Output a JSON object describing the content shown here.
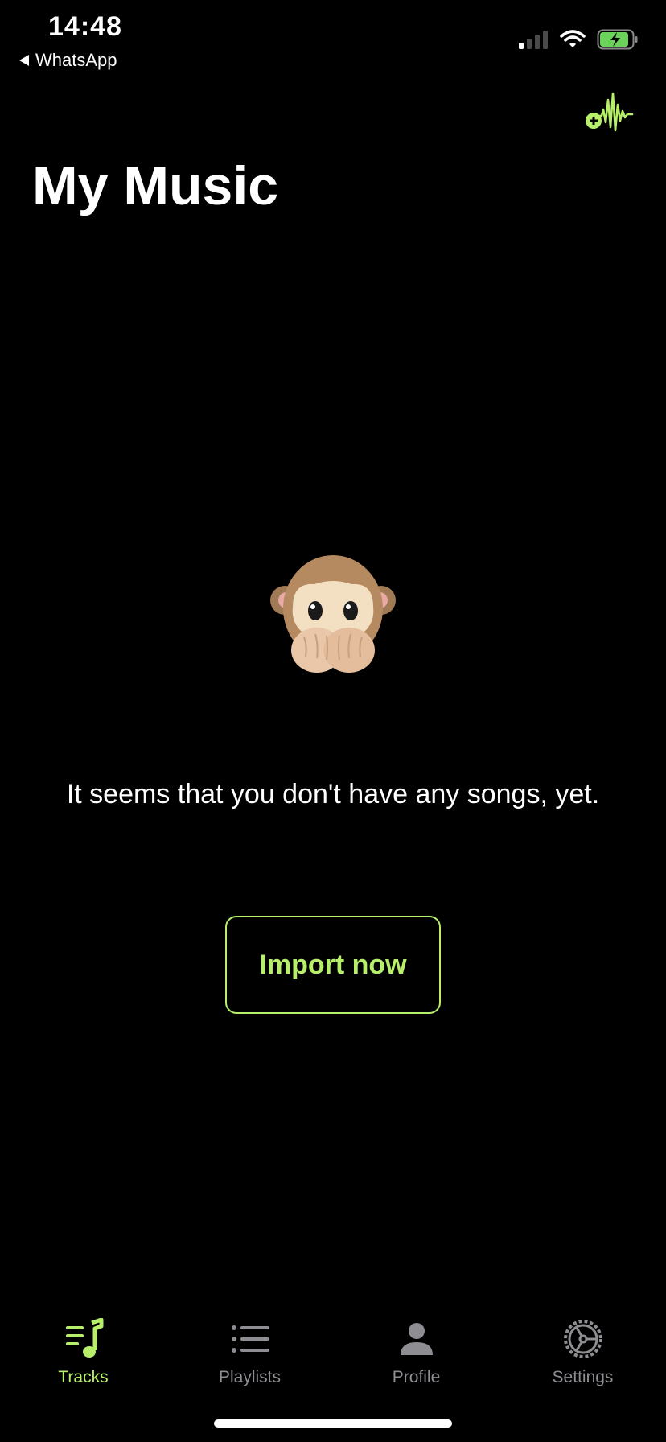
{
  "status_bar": {
    "time": "14:48",
    "back_app": "WhatsApp",
    "signal_icon": "cellular-signal-icon",
    "wifi_icon": "wifi-icon",
    "battery_icon": "battery-charging-icon"
  },
  "header": {
    "action_icon": "add-audio-waveform-icon",
    "title": "My Music"
  },
  "empty_state": {
    "illustration": "see-no-evil-monkey-speak-no-evil-monkey",
    "message": "It seems that you don't have any songs, yet.",
    "button_label": "Import now"
  },
  "tab_bar": {
    "tabs": [
      {
        "label": "Tracks",
        "icon": "music-list-icon",
        "active": true
      },
      {
        "label": "Playlists",
        "icon": "list-icon",
        "active": false
      },
      {
        "label": "Profile",
        "icon": "person-icon",
        "active": false
      },
      {
        "label": "Settings",
        "icon": "gear-icon",
        "active": false
      }
    ]
  },
  "colors": {
    "accent": "#b7ef6a",
    "background": "#000000",
    "inactive": "#8d8d92",
    "battery": "#6cd35a"
  }
}
